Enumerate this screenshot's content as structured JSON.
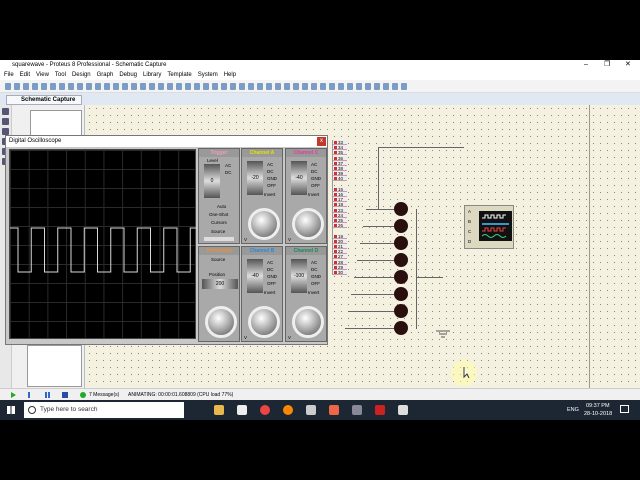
{
  "window": {
    "title": "squarewave - Proteus 8 Professional - Schematic Capture",
    "controls": [
      "–",
      "❐",
      "✕"
    ]
  },
  "menu": [
    "File",
    "Edit",
    "View",
    "Tool",
    "Design",
    "Graph",
    "Debug",
    "Library",
    "Template",
    "System",
    "Help"
  ],
  "tab": {
    "label": "Schematic Capture",
    "close": "x"
  },
  "oscilloscope": {
    "title": "Digital Oscilloscope",
    "close": "x",
    "trigger": {
      "title": "Trigger",
      "level_label": "Level",
      "level": "0",
      "modes": [
        "AC",
        "DC"
      ],
      "buttons": [
        "Auto",
        "One-Shot",
        "Cursors"
      ],
      "source_label": "Source",
      "sources": [
        "A",
        "B",
        "C",
        "D"
      ]
    },
    "horizontal": {
      "title": "Horizontal",
      "source_label": "Source",
      "position_label": "Position",
      "position": "200",
      "unit": "µs"
    },
    "channels": [
      {
        "title": "Channel A",
        "color": "#e8e000",
        "position": "-20",
        "modes": [
          "AC",
          "DC",
          "GND",
          "OFF"
        ],
        "invert": "Invert",
        "unit": "V"
      },
      {
        "title": "Channel C",
        "color": "#e0409a",
        "position": "-40",
        "modes": [
          "AC",
          "DC",
          "GND",
          "OFF"
        ],
        "invert": "Invert",
        "unit": "V"
      },
      {
        "title": "Channel B",
        "color": "#2a8ad8",
        "position": "-40",
        "modes": [
          "AC",
          "DC",
          "GND",
          "OFF"
        ],
        "invert": "Invert",
        "unit": "V"
      },
      {
        "title": "Channel D",
        "color": "#1a8a5a",
        "position": "-100",
        "modes": [
          "AC",
          "DC",
          "GND",
          "OFF"
        ],
        "invert": "Invert",
        "unit": "V"
      }
    ],
    "trace_color": "#d8d8d8"
  },
  "schematic": {
    "pins": [
      "33",
      "34",
      "35",
      "36",
      "37",
      "38",
      "39",
      "40",
      "",
      "15",
      "16",
      "17",
      "18",
      "23",
      "24",
      "25",
      "26",
      "",
      "19",
      "20",
      "21",
      "22",
      "27",
      "28",
      "29",
      "30"
    ],
    "scope_inputs": [
      "A",
      "B",
      "C",
      "D"
    ],
    "led_count": 8
  },
  "statusbar": {
    "messages": "7 Message(s)",
    "status": "ANIMATING: 00:00:01.608809 (CPU load 77%)"
  },
  "taskbar": {
    "search_placeholder": "Type here to search",
    "lang": "ENG",
    "time": "09:37 PM",
    "date": "28-10-2018"
  }
}
